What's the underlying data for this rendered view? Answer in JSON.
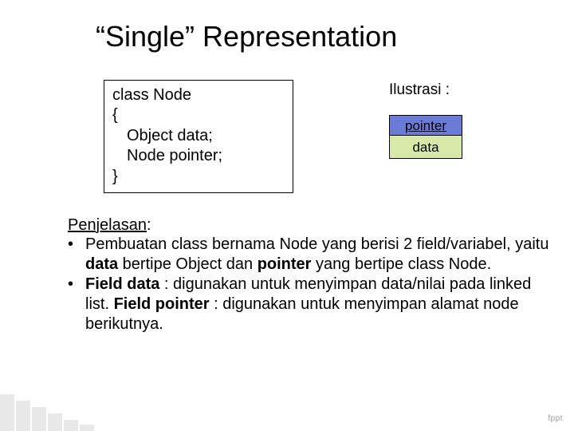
{
  "title": "“Single” Representation",
  "code": {
    "l1": "class Node",
    "l2": "{",
    "l3": "Object data;",
    "l4": "Node pointer;",
    "l5": "}"
  },
  "illustration": {
    "label": "Ilustrasi :",
    "pointer": "pointer",
    "data": "data"
  },
  "explain": {
    "heading": "Penjelasan",
    "colon": ":",
    "b1_pre": "Pembuatan class bernama Node yang berisi 2 field/variabel, yaitu ",
    "b1_bold1": "data",
    "b1_mid": " bertipe Object dan ",
    "b1_bold2": "pointer",
    "b1_post": " yang bertipe class Node.",
    "b2_bold1": "Field data",
    "b2_mid1": " : digunakan untuk menyimpan data/nilai pada linked list. ",
    "b2_bold2": "Field pointer",
    "b2_mid2": " : digunakan untuk menyimpan alamat node berikutnya."
  },
  "footer_logo": "fppt"
}
